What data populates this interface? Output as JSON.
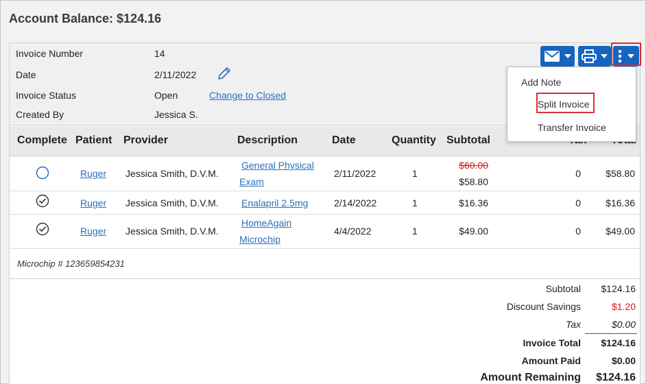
{
  "page": {
    "title": "Account Balance: $124.16"
  },
  "invoice_info": {
    "number_label": "Invoice Number",
    "number_value": "14",
    "date_label": "Date",
    "date_value": "2/11/2022",
    "status_label": "Invoice Status",
    "status_value": "Open",
    "status_link": "Change to Closed",
    "created_label": "Created By",
    "created_value": "Jessica S."
  },
  "toolbar": {
    "email_icon": "envelope-icon",
    "print_icon": "printer-icon",
    "more_icon": "vertical-ellipsis-icon",
    "accent_color": "#1565c0"
  },
  "more_menu": {
    "items": [
      "Add Note",
      "Split Invoice",
      "Transfer Invoice"
    ],
    "highlighted": "Split Invoice",
    "highlight_color": "#d6313a"
  },
  "table": {
    "headers": [
      "Complete",
      "Patient",
      "Provider",
      "Description",
      "Date",
      "Quantity",
      "Subtotal",
      "Tax",
      "Total"
    ],
    "rows": [
      {
        "complete": "unchecked",
        "patient": "Ruger",
        "provider": "Jessica Smith, D.V.M.",
        "desc1": "General Physical",
        "desc2": "Exam",
        "date": "2/11/2022",
        "quantity": "1",
        "original_subtotal": "$60.00",
        "subtotal": "$58.80",
        "tax": "0",
        "total": "$58.80"
      },
      {
        "complete": "checked",
        "patient": "Ruger",
        "provider": "Jessica Smith, D.V.M.",
        "desc1": "Enalapril 2.5mg",
        "desc2": "",
        "date": "2/14/2022",
        "quantity": "1",
        "original_subtotal": "",
        "subtotal": "$16.36",
        "tax": "0",
        "total": "$16.36"
      },
      {
        "complete": "checked",
        "patient": "Ruger",
        "provider": "Jessica Smith, D.V.M.",
        "desc1": "HomeAgain",
        "desc2": "Microchip",
        "date": "4/4/2022",
        "quantity": "1",
        "original_subtotal": "",
        "subtotal": "$49.00",
        "tax": "0",
        "total": "$49.00"
      }
    ]
  },
  "note": "Microchip # 123659854231",
  "totals": {
    "subtotal_label": "Subtotal",
    "subtotal_value": "$124.16",
    "discount_label": "Discount Savings",
    "discount_value": "$1.20",
    "tax_label": "Tax",
    "tax_value": "$0.00",
    "invoice_total_label": "Invoice Total",
    "invoice_total_value": "$124.16",
    "amount_paid_label": "Amount Paid",
    "amount_paid_value": "$0.00",
    "amount_remaining_label": "Amount Remaining",
    "amount_remaining_value": "$124.16"
  }
}
